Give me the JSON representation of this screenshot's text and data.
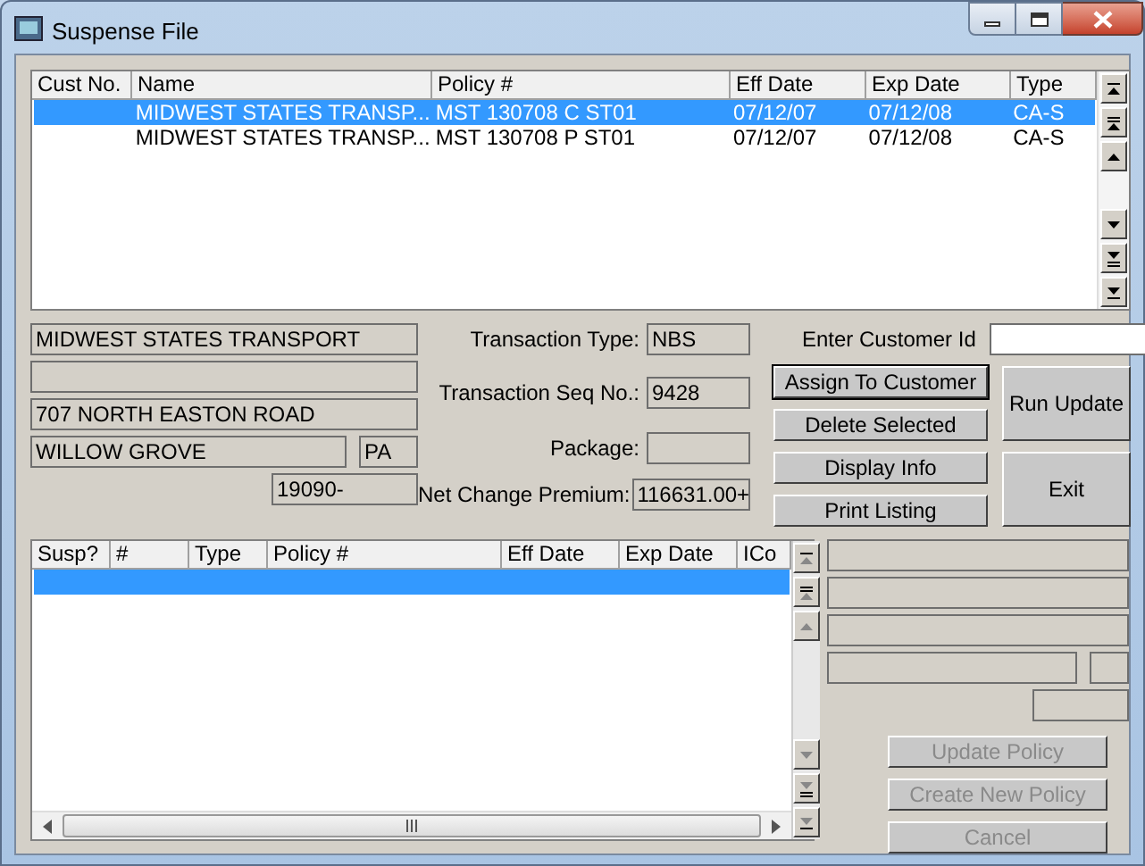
{
  "window": {
    "title": "Suspense File"
  },
  "suspense_list": {
    "columns": [
      "Cust No.",
      "Name",
      "Policy #",
      "Eff Date",
      "Exp Date",
      "Type"
    ],
    "rows": [
      {
        "cells": [
          "",
          "MIDWEST STATES TRANSP...",
          "MST 130708 C ST01",
          "07/12/07",
          "07/12/08",
          "CA-S"
        ],
        "selected": true
      },
      {
        "cells": [
          "",
          "MIDWEST STATES TRANSP...",
          "MST 130708 P ST01",
          "07/12/07",
          "07/12/08",
          "CA-S"
        ],
        "selected": false
      }
    ]
  },
  "customer": {
    "name": "MIDWEST STATES TRANSPORT",
    "address": "707 NORTH EASTON ROAD",
    "city": "WILLOW GROVE",
    "state": "PA",
    "zip": "19090-"
  },
  "transaction": [
    {
      "label": "Transaction Type:",
      "value": "NBS"
    },
    {
      "label": "Transaction Seq No.:",
      "value": "9428"
    },
    {
      "label": "Package:"
    },
    {
      "label": "Net Change Premium:",
      "value": "116631.00+"
    }
  ],
  "customer_id": {
    "label": "Enter Customer Id"
  },
  "actions": [
    {
      "label": "Assign To Customer",
      "focused": true
    },
    {
      "label": "Delete Selected",
      "focused": false
    },
    {
      "label": "Display Info",
      "focused": false
    },
    {
      "label": "Print Listing",
      "focused": false
    }
  ],
  "big_buttons": [
    {
      "label": "Run Update"
    },
    {
      "label": "Exit"
    }
  ],
  "policy_list": {
    "columns": [
      "Susp?",
      "#",
      "Type",
      "Policy #",
      "Eff Date",
      "Exp Date",
      "ICo"
    ],
    "rows": [
      {
        "selected": true
      }
    ]
  },
  "policy_buttons": [
    {
      "label": "Update Policy",
      "disabled": true
    },
    {
      "label": "Create New Policy",
      "disabled": true
    },
    {
      "label": "Cancel",
      "disabled": true
    }
  ]
}
